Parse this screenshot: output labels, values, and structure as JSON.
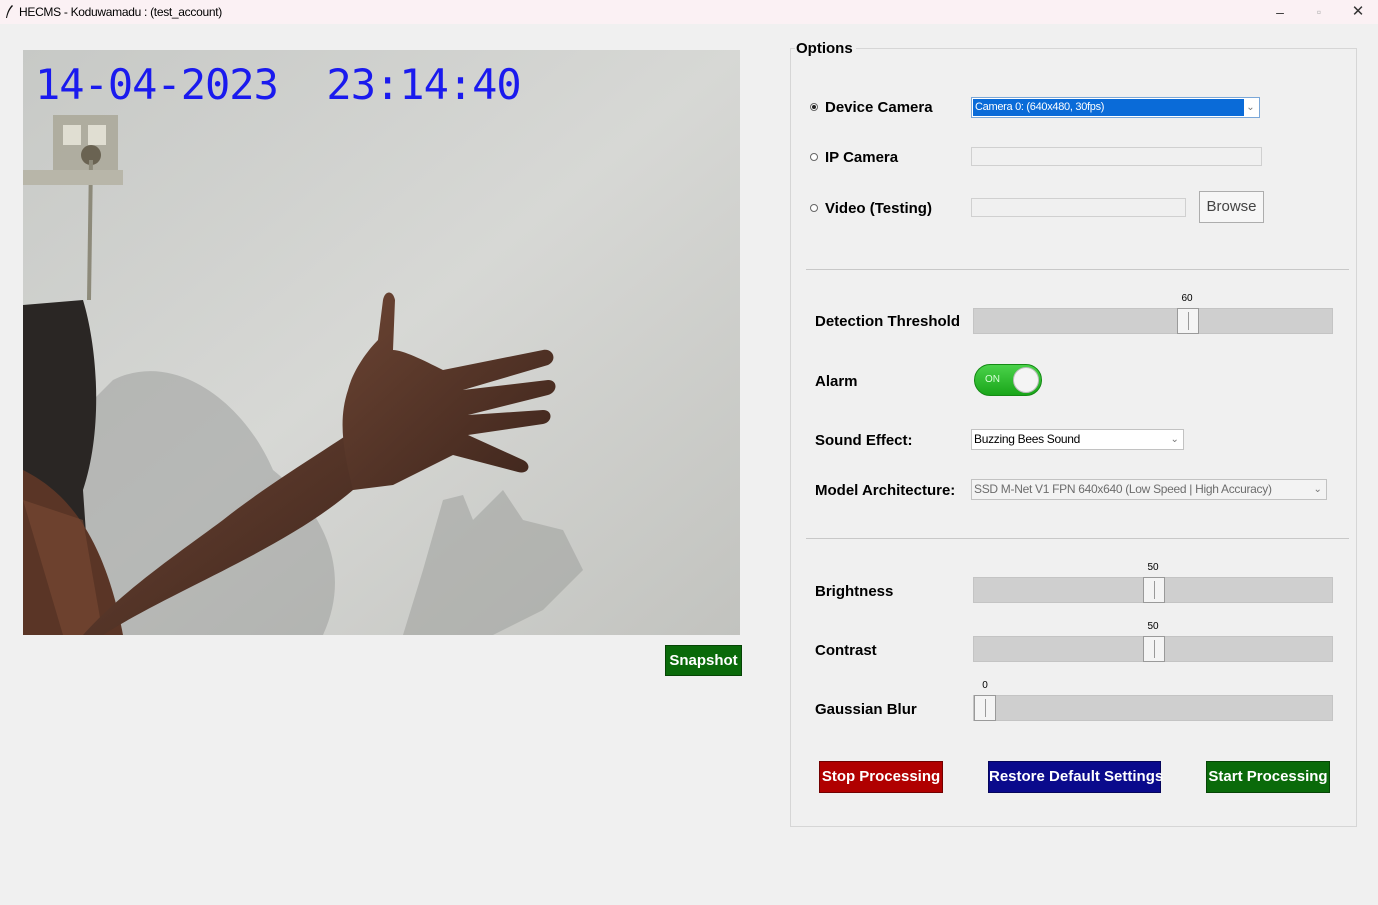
{
  "window": {
    "title": "HECMS - Koduwamadu : (test_account)",
    "minimize_glyph": "–",
    "maximize_glyph": "▫",
    "close_glyph": "✕"
  },
  "video": {
    "timestamp": "14-04-2023  23:14:40",
    "timestamp_color": "#1a1aee"
  },
  "snapshot_label": "Snapshot",
  "options": {
    "group_label": "Options",
    "sources": [
      {
        "label": "Device Camera",
        "selected": true
      },
      {
        "label": "IP Camera",
        "selected": false
      },
      {
        "label": "Video (Testing)",
        "selected": false
      }
    ],
    "camera_select_value": "Camera 0: (640x480, 30fps)",
    "ip_camera_value": "",
    "video_path_value": "",
    "browse_label": "Browse",
    "detection_threshold": {
      "label": "Detection Threshold",
      "value": "60",
      "min": 0,
      "max": 100
    },
    "alarm": {
      "label": "Alarm",
      "state": "ON",
      "on": true
    },
    "sound_effect": {
      "label": "Sound Effect:",
      "value": "Buzzing Bees Sound"
    },
    "model_architecture": {
      "label": "Model Architecture:",
      "value": "SSD M-Net V1 FPN 640x640 (Low Speed | High Accuracy)"
    },
    "brightness": {
      "label": "Brightness",
      "value": "50",
      "min": 0,
      "max": 100
    },
    "contrast": {
      "label": "Contrast",
      "value": "50",
      "min": 0,
      "max": 100
    },
    "gaussian_blur": {
      "label": "Gaussian Blur",
      "value": "0",
      "min": 0,
      "max": 100
    }
  },
  "actions": {
    "stop_label": "Stop Processing",
    "restore_label": "Restore Default Settings",
    "start_label": "Start Processing"
  },
  "colors": {
    "snapshot_green": "#0a6a0a",
    "stop_red": "#b00000",
    "restore_navy": "#0a0a8c",
    "start_green": "#0a6a0a",
    "toggle_green": "#2ab82a",
    "selection_blue": "#0a6bd8"
  },
  "icons": {
    "app": "feather-icon",
    "dropdown": "chevron-down-icon"
  }
}
